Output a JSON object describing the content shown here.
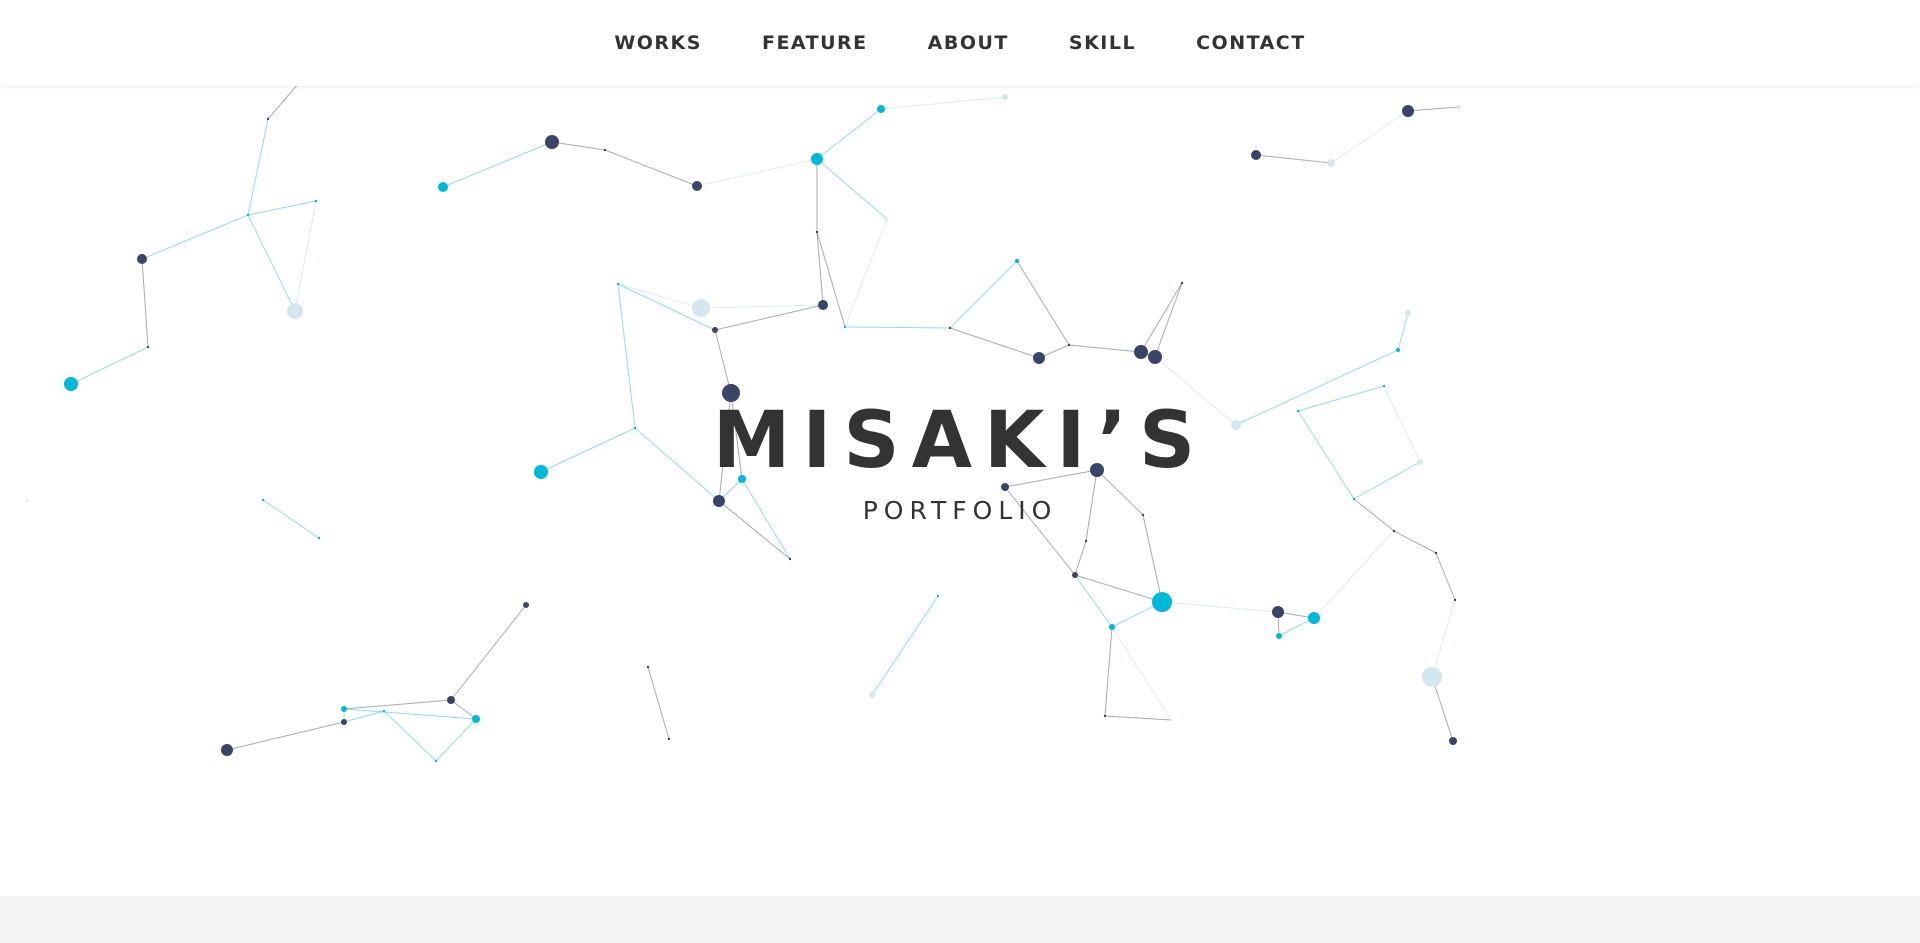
{
  "nav": {
    "items": [
      {
        "label": "WORKS"
      },
      {
        "label": "FEATURE"
      },
      {
        "label": "ABOUT"
      },
      {
        "label": "SKILL"
      },
      {
        "label": "CONTACT"
      }
    ]
  },
  "hero": {
    "title": "MISAKI’S",
    "subtitle": "PORTFOLIO"
  },
  "colors": {
    "accent": "#00b8d9",
    "node_dark": "#3a4468",
    "text": "#333333",
    "footer_band": "#f5f5f5"
  }
}
